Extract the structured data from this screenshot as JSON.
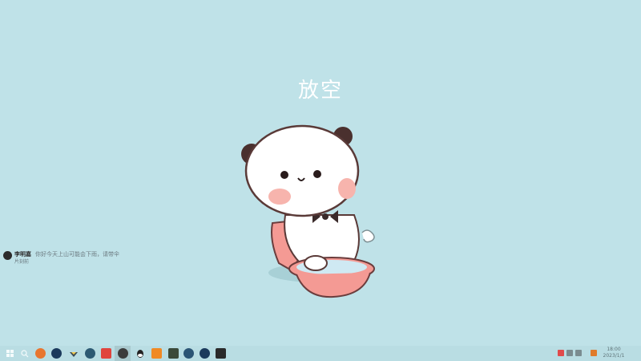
{
  "wallpaper": {
    "title": "放空",
    "background_color": "#bfe2e8"
  },
  "widget": {
    "name": "李明嘉",
    "message": "你好今天上山可能会下雨，请带伞",
    "sub": "片刻前"
  },
  "taskbar": {
    "icons": [
      {
        "name": "windows-start-icon",
        "color": "#e8f4f6"
      },
      {
        "name": "search-icon",
        "color": "#e8f4f6"
      },
      {
        "name": "firefox-icon",
        "color": "#e8762f"
      },
      {
        "name": "steam-icon",
        "color": "#1b3a5c"
      },
      {
        "name": "network-app-icon",
        "color": "#3b4a53"
      },
      {
        "name": "circle-app-icon",
        "color": "#2d5a73"
      },
      {
        "name": "music-app-icon",
        "color": "#e0443d"
      },
      {
        "name": "active-app-icon",
        "color": "#3c3c3c"
      },
      {
        "name": "qq-icon",
        "color": "#222222"
      },
      {
        "name": "orange-app-icon",
        "color": "#f08a24"
      },
      {
        "name": "clapper-app-icon",
        "color": "#3b4a3a"
      },
      {
        "name": "blue-circle-app-icon",
        "color": "#2b5575"
      },
      {
        "name": "steam-client-icon",
        "color": "#1b3a5c"
      },
      {
        "name": "terminal-app-icon",
        "color": "#2a2a2a"
      }
    ],
    "tray": {
      "colors": [
        "#e04b4b",
        "#7a8c90",
        "#7a8c90",
        "#e07b2a"
      ]
    },
    "clock": {
      "time": "18:00",
      "date": "2023/1/1"
    }
  }
}
